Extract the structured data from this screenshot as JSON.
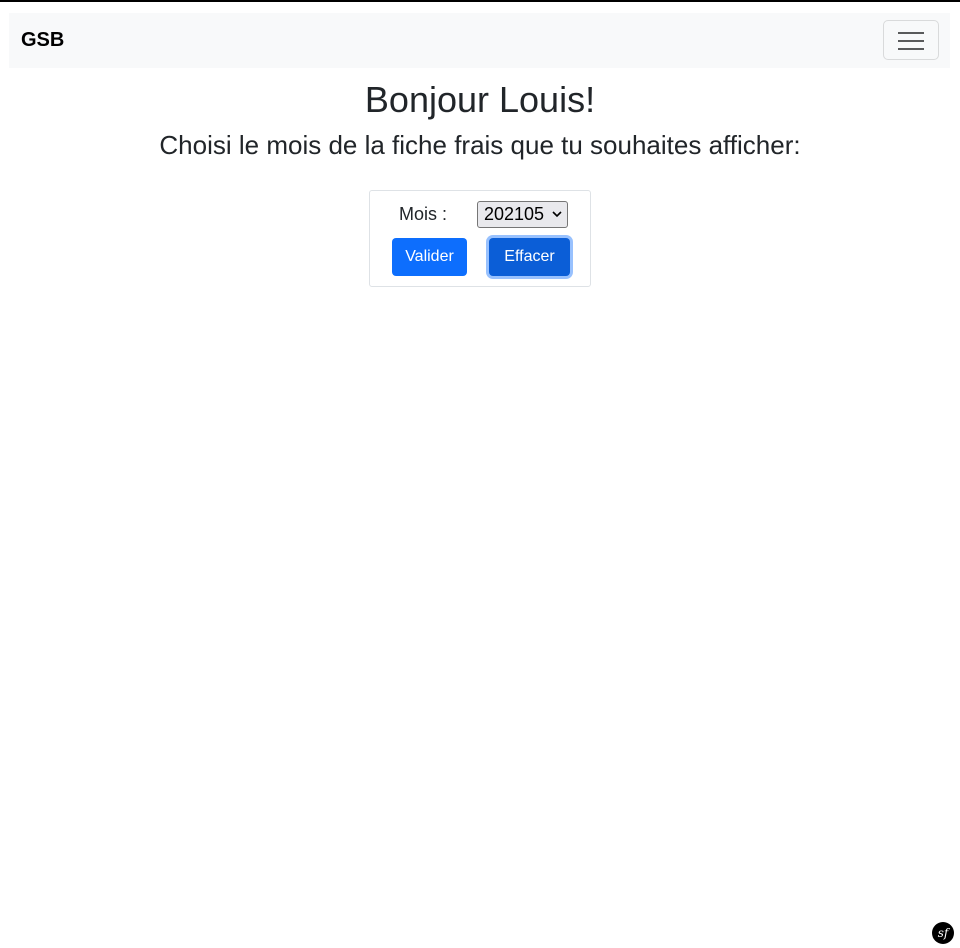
{
  "navbar": {
    "brand": "GSB",
    "toggler_icon": "hamburger-menu-icon"
  },
  "main": {
    "greeting": "Bonjour Louis!",
    "subtitle": "Choisi le mois de la fiche frais que tu souhaites afficher:"
  },
  "form": {
    "mois_label": "Mois :",
    "mois_selected": "202105",
    "valider_label": "Valider",
    "effacer_label": "Effacer"
  },
  "footer": {
    "toolbar_logo": "sf",
    "toolbar_icon": "symfony-logo-icon"
  },
  "colors": {
    "primary": "#0d6efd",
    "primary_active": "#0b5ed7",
    "navbar_bg": "#f8f9fa"
  }
}
